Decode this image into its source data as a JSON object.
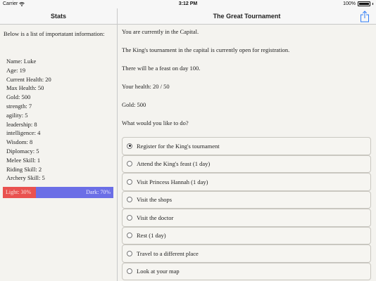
{
  "status": {
    "carrier": "Carrier",
    "time": "3:12 PM",
    "battery": "100%"
  },
  "nav": {
    "left_title": "Stats",
    "right_title": "The Great Tournament",
    "share_icon": "share-icon"
  },
  "sidebar": {
    "intro": "Below is a list of importatant information:",
    "stats": [
      "Name: Luke",
      "Age: 19",
      "Current Health: 20",
      "Max Health: 50",
      "Gold: 500",
      "strength: 7",
      "agility: 5",
      "leadership: 8",
      "intelligence: 4",
      "Wisdom: 8",
      "Diplomacy: 5",
      "Melee Skill: 1",
      "Riding Skill: 2",
      "Archery Skill: 5"
    ],
    "alignment": {
      "light_label": "Light: 30%",
      "dark_label": "Dark: 70%",
      "light_fraction": 0.3,
      "light_color": "#e9514f",
      "dark_color": "#6b6ee6"
    }
  },
  "main": {
    "messages": [
      "You are currently in the Capital.",
      "The King's tournament in the capital is currently open for registration.",
      "There will be a feast on day 100.",
      "Your health: 20 / 50",
      "Gold: 500",
      "What would you like to do?"
    ],
    "options": [
      {
        "label": "Register for the King's tournament",
        "selected": true
      },
      {
        "label": "Attend the King's feast (1 day)",
        "selected": false
      },
      {
        "label": "Visit Princess Hannah (1 day)",
        "selected": false
      },
      {
        "label": "Visit the shops",
        "selected": false
      },
      {
        "label": "Visit the doctor",
        "selected": false
      },
      {
        "label": "Rest (1 day)",
        "selected": false
      },
      {
        "label": "Travel to a different place",
        "selected": false
      },
      {
        "label": "Look at your map",
        "selected": false
      }
    ]
  }
}
